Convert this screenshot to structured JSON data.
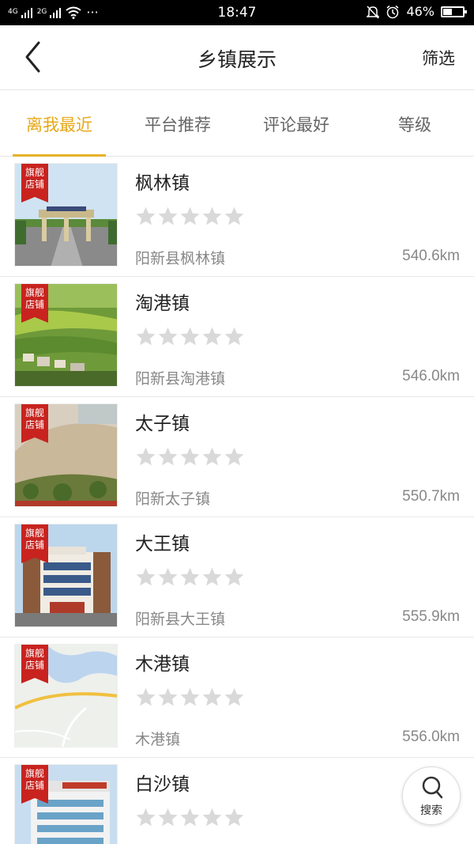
{
  "status_bar": {
    "time": "18:47",
    "network_1": "4G",
    "network_2": "2G",
    "more": "···",
    "battery": "46%",
    "battery_level": 0.46,
    "icons": [
      "signal-icon",
      "wifi-icon",
      "mute-icon",
      "alarm-icon",
      "battery-icon"
    ]
  },
  "header": {
    "back_icon": "chevron-left-icon",
    "title": "乡镇展示",
    "filter_label": "筛选"
  },
  "tabs": [
    {
      "label": "离我最近",
      "active": true
    },
    {
      "label": "平台推荐",
      "active": false
    },
    {
      "label": "评论最好",
      "active": false
    },
    {
      "label": "等级",
      "active": false
    }
  ],
  "items": [
    {
      "badge": [
        "旗舰",
        "店铺"
      ],
      "name": "枫林镇",
      "address": "阳新县枫林镇",
      "distance": "540.6km",
      "rating": 0,
      "max_rating": 5
    },
    {
      "badge": [
        "旗舰",
        "店铺"
      ],
      "name": "淘港镇",
      "address": "阳新县淘港镇",
      "distance": "546.0km",
      "rating": 0,
      "max_rating": 5
    },
    {
      "badge": [
        "旗舰",
        "店铺"
      ],
      "name": "太子镇",
      "address": "阳新太子镇",
      "distance": "550.7km",
      "rating": 0,
      "max_rating": 5
    },
    {
      "badge": [
        "旗舰",
        "店铺"
      ],
      "name": "大王镇",
      "address": "阳新县大王镇",
      "distance": "555.9km",
      "rating": 0,
      "max_rating": 5
    },
    {
      "badge": [
        "旗舰",
        "店铺"
      ],
      "name": "木港镇",
      "address": "木港镇",
      "distance": "556.0km",
      "rating": 0,
      "max_rating": 5
    },
    {
      "badge": [
        "旗舰",
        "店铺"
      ],
      "name": "白沙镇",
      "address": "",
      "distance": "",
      "rating": 0,
      "max_rating": 5
    }
  ],
  "search_fab": {
    "icon": "search-icon",
    "label": "搜索"
  }
}
